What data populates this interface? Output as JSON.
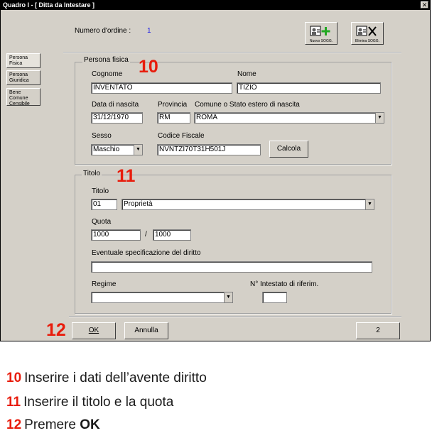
{
  "window": {
    "title": "Quadro I - [ Ditta da Intestare ]",
    "close_glyph": "✕"
  },
  "header": {
    "order_label": "Numero d'ordine :",
    "order_value": "1"
  },
  "toolbar": {
    "new_label": "Nuovo SOGG.",
    "delete_label": "Elimina SOGG.",
    "new_icon": "add-person-icon",
    "delete_icon": "delete-person-icon"
  },
  "side_tabs": [
    {
      "label": "Persona Fisica"
    },
    {
      "label": "Persona Giuridica"
    },
    {
      "label": "Bene Comune Censibile"
    }
  ],
  "persona": {
    "group_title": "Persona fisica",
    "cognome_label": "Cognome",
    "cognome_value": "INVENTATO",
    "nome_label": "Nome",
    "nome_value": "TIZIO",
    "data_label": "Data di nascita",
    "data_value": "31/12/1970",
    "provincia_label": "Provincia",
    "provincia_value": "RM",
    "comune_label": "Comune o Stato estero di nascita",
    "comune_value": "ROMA",
    "sesso_label": "Sesso",
    "sesso_value": "Maschio",
    "cf_label": "Codice Fiscale",
    "cf_value": "NVNTZI70T31H501J",
    "calcola_label": "Calcola"
  },
  "titolo": {
    "group_title": "Titolo",
    "titolo_label": "Titolo",
    "titolo_code": "01",
    "titolo_value": "Proprietà",
    "quota_label": "Quota",
    "quota_num": "1000",
    "quota_sep": "/",
    "quota_den": "1000",
    "spec_label": "Eventuale specificazione del diritto",
    "spec_value": "",
    "regime_label": "Regime",
    "regime_value": "",
    "intestato_label": "N° Intestato di riferim.",
    "intestato_value": ""
  },
  "buttons": {
    "ok": "OK",
    "annulla": "Annulla",
    "page": "2"
  },
  "callouts": {
    "c10": "10",
    "c11": "11",
    "c12": "12"
  },
  "legend": [
    {
      "num": "10",
      "text": "Inserire i dati dell’avente diritto"
    },
    {
      "num": "11",
      "text": "Inserire il titolo e la quota"
    },
    {
      "num": "12",
      "text_pre": "Premere ",
      "text_bold": "OK"
    }
  ],
  "colors": {
    "accent": "#e81c0c",
    "window_bg": "#d4d0c8",
    "value_blue": "#1a1ae6"
  }
}
